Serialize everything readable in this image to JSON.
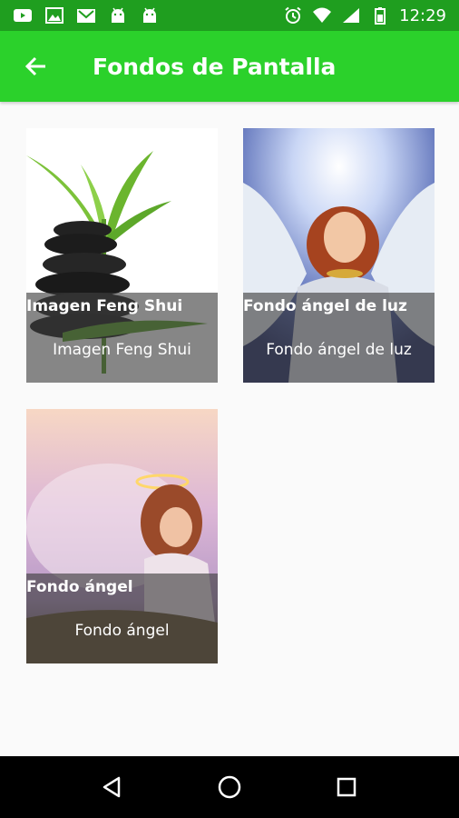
{
  "status_bar": {
    "time": "12:29",
    "left_icons": [
      "youtube-icon",
      "image-icon",
      "gmail-icon",
      "android-icon",
      "android-icon"
    ],
    "right_icons": [
      "alarm-icon",
      "wifi-icon",
      "signal-icon",
      "battery-icon"
    ]
  },
  "app_bar": {
    "title": "Fondos de Pantalla",
    "back_icon": "arrow-back-icon",
    "color": "#2bd12b"
  },
  "wallpapers": [
    {
      "title": "Imagen Feng Shui",
      "subtitle": "Imagen Feng Shui"
    },
    {
      "title": "Fondo ángel de luz",
      "subtitle": "Fondo ángel de luz"
    },
    {
      "title": "Fondo ángel",
      "subtitle": "Fondo ángel"
    }
  ],
  "nav_bar": {
    "buttons": [
      "back-triangle-icon",
      "home-circle-icon",
      "recents-square-icon"
    ]
  }
}
